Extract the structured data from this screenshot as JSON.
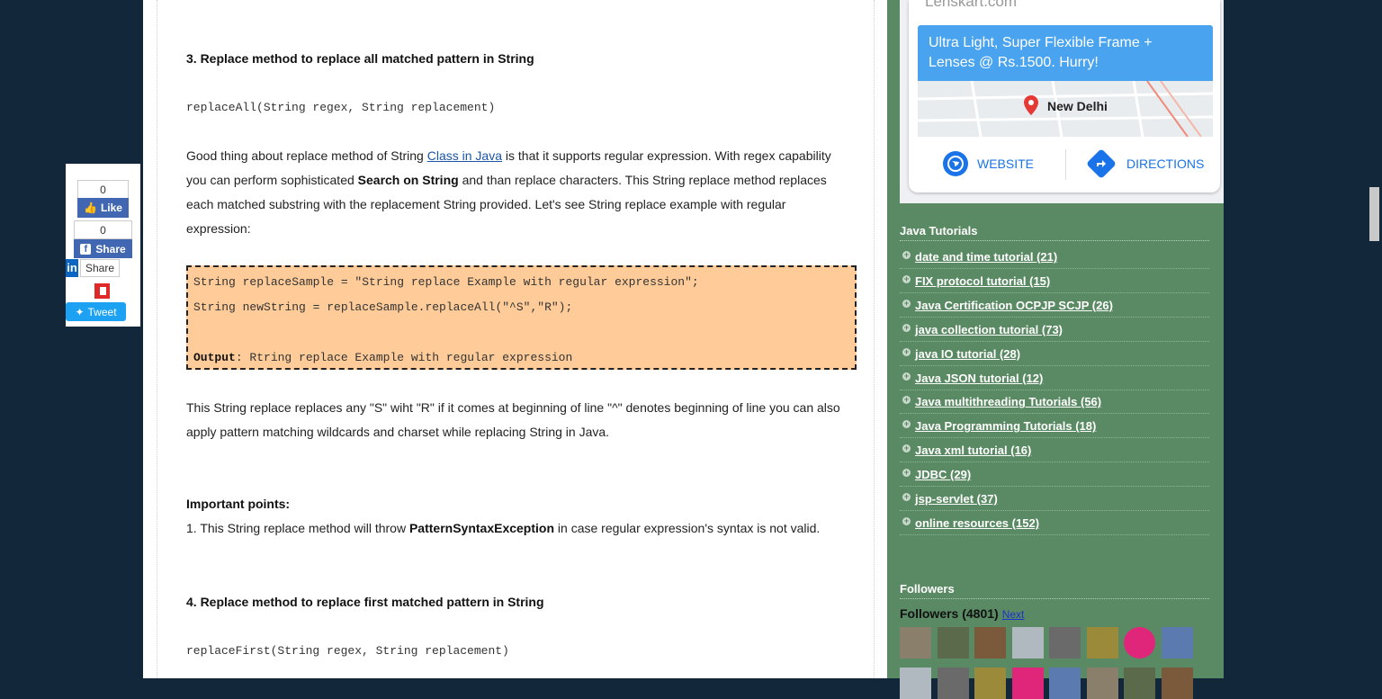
{
  "article": {
    "heading3": "3. Replace method to replace all matched pattern in String",
    "sig3": "replaceAll(String regex, String replacement)",
    "para1": {
      "a": "Good thing about replace method of String ",
      "link": "Class in Java",
      "b": " is that it supports regular expression. With regex capability you can perform sophisticated ",
      "bold": "Search on String",
      "c": " and than replace characters. This String replace method replaces each matched substring with the replacement String provided. Let's see String replace example with regular expression:"
    },
    "code": {
      "line1": "String replaceSample = \"String replace Example with regular expression\";",
      "line2": "String newString = replaceSample.replaceAll(\"^S\",\"R\");",
      "output_label": "Output",
      "output_value": ": Rtring replace Example with regular expression"
    },
    "para2": "This String replace replaces any \"S\" wiht \"R\" if it comes at beginning of line \"^\" denotes beginning of line you can also apply pattern matching wildcards and charset while replacing String in Java.",
    "important_title": "Important points:",
    "point1": {
      "a": "1. This String replace method will throw ",
      "bold": "PatternSyntaxException",
      "b": " in case regular expression's syntax is not valid."
    },
    "heading4": "4. Replace method to replace first matched pattern in String",
    "sig4": "replaceFirst(String regex, String replacement)"
  },
  "share": {
    "like_count": "0",
    "like_label": "Like",
    "share_count": "0",
    "share_label": "Share",
    "linkedin_label": "Share",
    "tweet_label": "Tweet"
  },
  "ad": {
    "domain": "Lenskart.com",
    "headline": "Ultra Light, Super Flexible Frame + Lenses @ Rs.1500. Hurry!",
    "city": "New Delhi",
    "website_label": "WEBSITE",
    "directions_label": "DIRECTIONS"
  },
  "tutorials": {
    "title": "Java Tutorials",
    "items": [
      {
        "label": "date and time tutorial",
        "count": "(21)"
      },
      {
        "label": "FIX protocol tutorial",
        "count": "(15)"
      },
      {
        "label": "Java Certification OCPJP SCJP",
        "count": "(26)"
      },
      {
        "label": "java collection tutorial",
        "count": "(73)"
      },
      {
        "label": "java IO tutorial",
        "count": "(28)"
      },
      {
        "label": "Java JSON tutorial",
        "count": "(12)"
      },
      {
        "label": "Java multithreading Tutorials",
        "count": "(56)"
      },
      {
        "label": "Java Programming Tutorials",
        "count": "(18)"
      },
      {
        "label": "Java xml tutorial",
        "count": "(16)"
      },
      {
        "label": "JDBC",
        "count": "(29)"
      },
      {
        "label": "jsp-servlet",
        "count": "(37)"
      },
      {
        "label": "online resources",
        "count": "(152)"
      }
    ]
  },
  "followers": {
    "title": "Followers",
    "count_text": "Followers (4801)",
    "next_label": "Next"
  },
  "colors": {
    "sidebar_bg": "#5a8a63",
    "page_bg": "#13273a",
    "code_bg": "#ffcc99",
    "ad_blue": "#4aa3ee",
    "fb_blue": "#4267b2",
    "tweet_blue": "#1da1f2"
  }
}
